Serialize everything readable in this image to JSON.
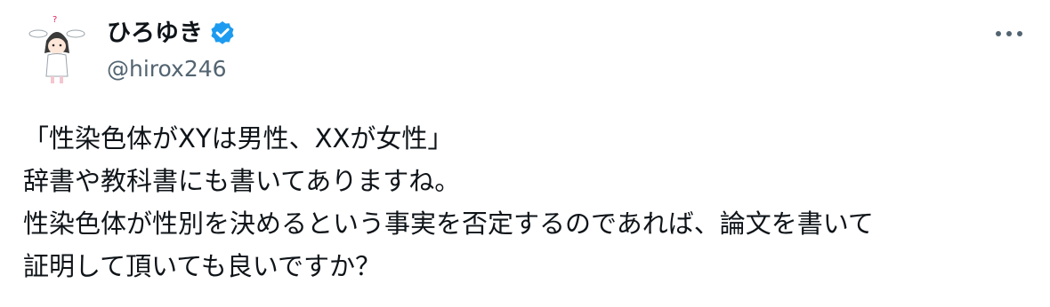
{
  "author": {
    "display_name": "ひろゆき",
    "handle": "@hirox246",
    "verified_icon": "verified-badge-icon",
    "avatar_icon": "avatar-illustration",
    "verified_color": "#1d9bf0"
  },
  "menu": {
    "more_icon": "more-horizontal-icon"
  },
  "tweet": {
    "lines": [
      "「性染色体がXYは男性、XXが女性」",
      "辞書や教科書にも書いてありますね。",
      "性染色体が性別を決めるという事実を否定するのであれば、論文を書いて",
      "証明して頂いても良いですか？"
    ]
  }
}
